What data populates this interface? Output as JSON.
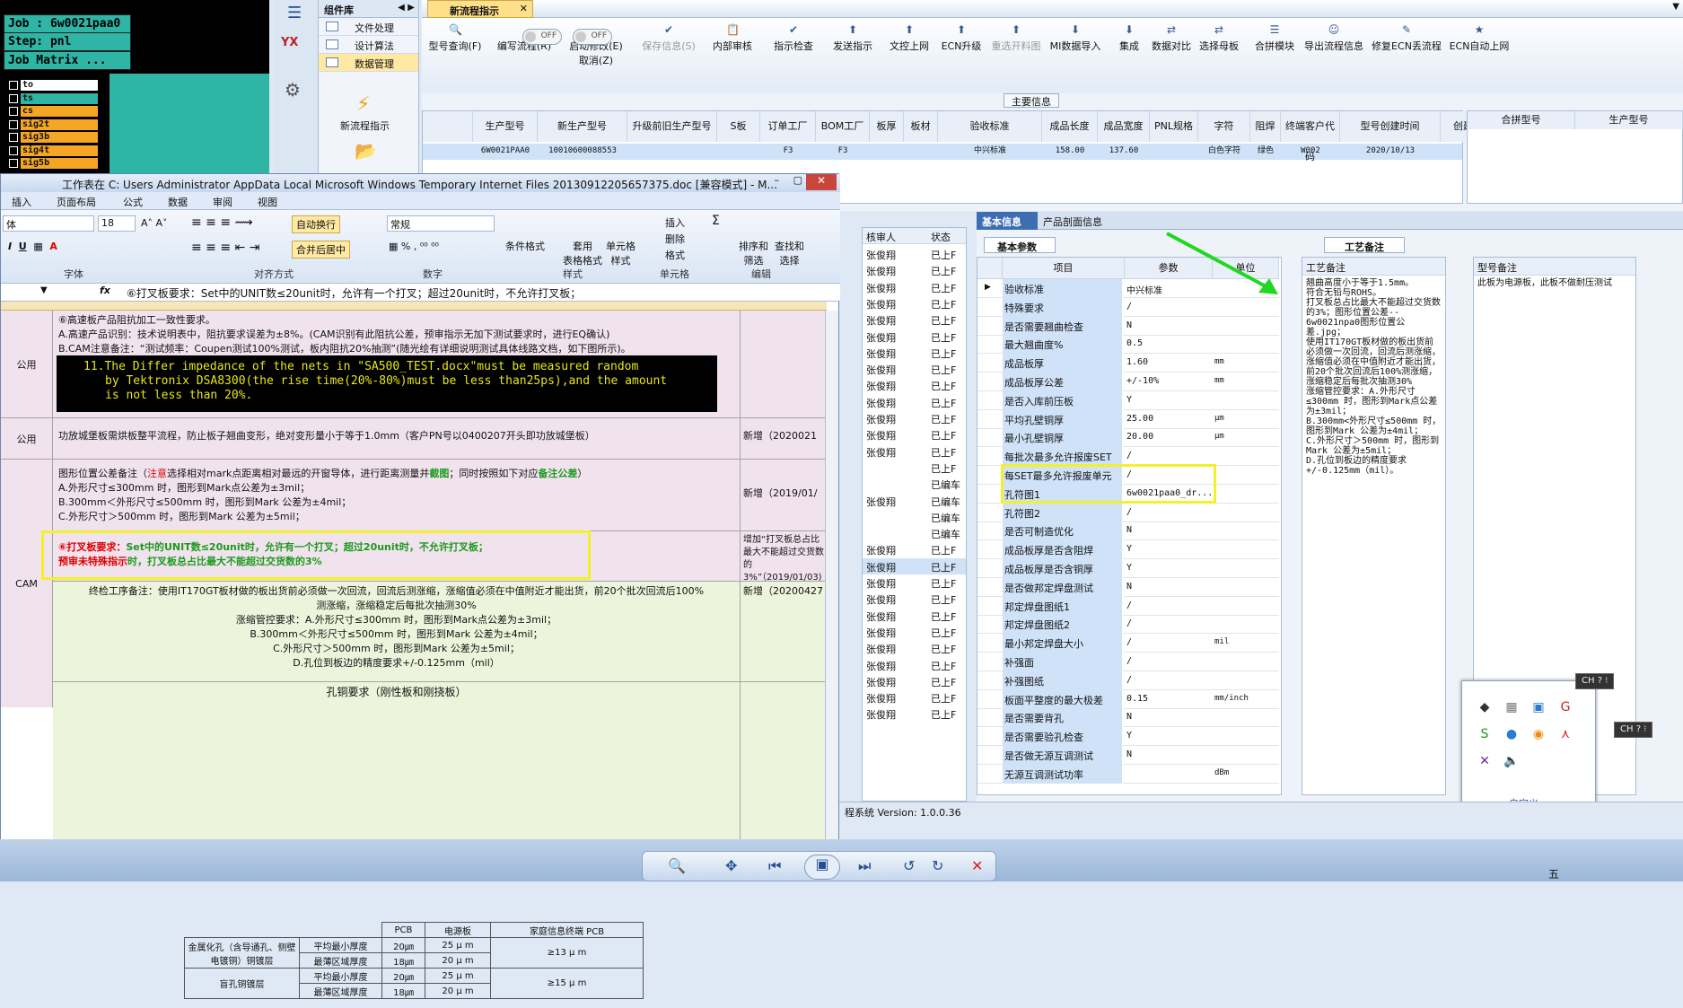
{
  "terminal": {
    "job_line": "Job : 6w0021paa0",
    "step_line": "Step: pnl",
    "matrix_btn": "Job Matrix ...",
    "layers": [
      {
        "name": "to",
        "color": "#ffffff"
      },
      {
        "name": "ts",
        "color": "#2fb5a5"
      },
      {
        "name": "cs",
        "color": "#f5a623"
      },
      {
        "name": "sig2t",
        "color": "#f5a623"
      },
      {
        "name": "sig3b",
        "color": "#f5a623"
      },
      {
        "name": "sig4t",
        "color": "#f5a623"
      },
      {
        "name": "sig5b",
        "color": "#f5a623"
      }
    ]
  },
  "sidebar": {
    "logo": "YX"
  },
  "component_lib": {
    "title": "组件库",
    "items": [
      "文件处理",
      "设计算法",
      "数据管理"
    ],
    "new_flow": "新流程指示",
    "open": "开启"
  },
  "app": {
    "tab": "新流程指示",
    "toolbar": [
      {
        "label": "型号查询(F)",
        "icon": "🔍"
      },
      {
        "label": "编写流程(R)",
        "icon": ""
      },
      {
        "label": "启动修改(E)\n取消(Z)",
        "icon": ""
      },
      {
        "label": "保存信息(S)",
        "icon": "✔",
        "disabled": true
      },
      {
        "label": "内部审核",
        "icon": "📋"
      },
      {
        "label": "指示检查",
        "icon": "✔"
      },
      {
        "label": "发送指示",
        "icon": "⬆"
      },
      {
        "label": "文控上网",
        "icon": "⬆"
      },
      {
        "label": "ECN升级",
        "icon": "⬆"
      },
      {
        "label": "重选开料图",
        "icon": "⬆",
        "disabled": true
      },
      {
        "label": "MI数据导入",
        "icon": "⬇"
      },
      {
        "label": "集成",
        "icon": "⬇"
      },
      {
        "label": "数据对比",
        "icon": "⇄"
      },
      {
        "label": "选择母板",
        "icon": "⇄"
      },
      {
        "label": "合拼模块",
        "icon": "☰"
      },
      {
        "label": "导出流程信息",
        "icon": "☺"
      },
      {
        "label": "修复ECN丢流程",
        "icon": "✎"
      },
      {
        "label": "ECN自动上网",
        "icon": "★"
      }
    ],
    "toggle_off": "OFF",
    "main_info": "主要信息",
    "grid": {
      "headers": [
        "生产型号",
        "新生产型号",
        "升级前旧生产型号",
        "S板",
        "订单工厂",
        "BOM工厂",
        "板厚",
        "板材",
        "验收标准",
        "成品长度",
        "成品宽度",
        "PNL规格",
        "字符",
        "阻焊",
        "终端客户代码",
        "型号创建时间",
        "创建人"
      ],
      "row": [
        "6W0021PAA0",
        "10010600088553",
        "",
        "",
        "F3",
        "F3",
        "",
        "",
        "中兴标准",
        "158.00",
        "137.60",
        "",
        "白色字符",
        "绿色",
        "W002",
        "2020/10/13",
        ""
      ]
    },
    "grid_right_headers": [
      "合拼型号",
      "生产型号"
    ]
  },
  "excel": {
    "title": "工作表在 C: Users Administrator AppData Local Microsoft Windows Temporary Internet Files 20130912205657375.doc [兼容模式] - M...",
    "tabs": [
      "插入",
      "页面布局",
      "公式",
      "数据",
      "审阅",
      "视图"
    ],
    "font_name": "体",
    "font_size": "18",
    "wrap": "自动换行",
    "merge": "合并后居中",
    "number_fmt": "常规",
    "buttons": [
      "条件格式",
      "套用\n表格格式",
      "单元格\n样式",
      "插入",
      "删除",
      "格式",
      "排序和\n筛选",
      "查找和\n选择"
    ],
    "groups": [
      "字体",
      "对齐方式",
      "数字",
      "样式",
      "单元格",
      "编辑"
    ],
    "formula": "⑥打叉板要求：Set中的UNIT数≤20unit时，允许有一个打叉；超过20unit时，不允许打叉板；",
    "rows": {
      "r1_lines": [
        "⑥高速板产品阻抗加工一致性要求。",
        "A.高速产品识别：技术说明表中，阻抗要求误差为±8%。(CAM识别有此阻抗公差，预审指示无加下测试要求时，进行EQ确认)",
        "B.CAM注意备注：“测试频率：Coupen测试100%测试，板内阻抗20%抽测”(随光绘有详细说明测试具体线路文档，如下图所示)。"
      ],
      "r1_label": "公用",
      "black_lines": [
        "11.The Differ impedance of the nets in \"SA500_TEST.docx\"must be measured random",
        "by Tektronix DSA8300(the rise time(20%-80%)must be less than25ps),and the amount",
        "is not less than 20%."
      ],
      "r2_label": "公用",
      "r2_text": "功放城堡板需烘板整平流程，防止板子翘曲变形，绝对变形量小于等于1.0mm（客户PN号以0400207开头即功放城堡板）",
      "r2_note": "新增（2020021",
      "cam_label": "CAM",
      "r3_line1": "图形位置公差备注（",
      "r3_attention": "注意",
      "r3_line1b": "选择相对mark点距离相对最远的开窗导体，进行距离测量并",
      "r3_shot": "截图",
      "r3_line1c": "；同时按照如下对应",
      "r3_tol": "备注公差",
      "r3_lines": [
        "A.外形尺寸≤300mm 时，图形到Mark点公差为±3mil；",
        "B.300mm＜外形尺寸≤500mm 时，图形到Mark 公差为±4mil；",
        "C.外形尺寸＞500mm 时，图形到Mark 公差为±5mil；"
      ],
      "r3_note": "新增（2019/01/",
      "r4_prefix": "⑥打叉板要求：",
      "r4_main": "Set中的UNIT数≤20unit时，允许有一个打叉；超过20unit时，不允许打叉板；",
      "r4_prefix2": "预审未特殊指示",
      "r4_main2": "时，打叉板总占比最大不能超过交货数的3%",
      "r4_note": "增加“打叉板总占比最大不能超过交货数的3%”（2019/01/03)",
      "r5_lines": [
        "终检工序备注：使用IT170GT板材做的板出货前必须做一次回流，回流后测涨缩，涨缩值必须在中值附近才能出货，前20个批次回流后100%",
        "测涨缩，涨缩稳定后每批次抽测30%",
        "涨缩管控要求：A.外形尺寸≤300mm 时，图形到Mark点公差为±3mil；",
        "B.300mm＜外形尺寸≤500mm 时，图形到Mark 公差为±4mil；",
        "C.外形尺寸＞500mm 时，图形到Mark 公差为±5mil；",
        "D.孔位到板边的精度要求+/-0.125mm（mil）"
      ],
      "r5_note": "新增（20200427",
      "r6_title": "孔铜要求（刚性板和刚挠板）",
      "sub_headers": [
        "PCB",
        "电源板",
        "家庭信息终端 PCB"
      ],
      "sub_rows": [
        [
          "金属化孔（含导通孔、侧壁电镀铜）铜镀层",
          "平均最小厚度",
          "20㎛",
          "25 μ m",
          "≥13 μ m"
        ],
        [
          "",
          "最薄区域厚度",
          "18㎛",
          "20 μ m",
          ""
        ],
        [
          "盲孔铜镀层",
          "平均最小厚度",
          "20㎛",
          "25 μ m",
          "≥15 μ m"
        ],
        [
          "",
          "最薄区域厚度",
          "18㎛",
          "20 μ m",
          ""
        ]
      ]
    }
  },
  "mid_list": {
    "headers": [
      "核审人",
      "状态"
    ],
    "rows": [
      [
        "张俊翔",
        "已上F"
      ],
      [
        "张俊翔",
        "已上F"
      ],
      [
        "张俊翔",
        "已上F"
      ],
      [
        "张俊翔",
        "已上F"
      ],
      [
        "张俊翔",
        "已上F"
      ],
      [
        "张俊翔",
        "已上F"
      ],
      [
        "张俊翔",
        "已上F"
      ],
      [
        "张俊翔",
        "已上F"
      ],
      [
        "张俊翔",
        "已上F"
      ],
      [
        "张俊翔",
        "已上F"
      ],
      [
        "张俊翔",
        "已上F"
      ],
      [
        "张俊翔",
        "已上F"
      ],
      [
        "张俊翔",
        "已上F"
      ],
      [
        "",
        "已上F"
      ],
      [
        "",
        "已编车"
      ],
      [
        "张俊翔",
        "已编车"
      ],
      [
        "",
        "已编车"
      ],
      [
        "",
        "已编车"
      ],
      [
        "张俊翔",
        "已上F"
      ],
      [
        "张俊翔",
        "已上F"
      ],
      [
        "张俊翔",
        "已上F"
      ],
      [
        "张俊翔",
        "已上F"
      ],
      [
        "张俊翔",
        "已上F"
      ],
      [
        "张俊翔",
        "已上F"
      ],
      [
        "张俊翔",
        "已上F"
      ],
      [
        "张俊翔",
        "已上F"
      ],
      [
        "张俊翔",
        "已上F"
      ],
      [
        "张俊翔",
        "已上F"
      ],
      [
        "张俊翔",
        "已上F"
      ]
    ]
  },
  "info": {
    "tab1": "基本信息",
    "tab2": "产品剖面信息",
    "param_tab": "基本参数",
    "headers": [
      "项目",
      "参数",
      "单位"
    ],
    "rows": [
      [
        "验收标准",
        "中兴标准",
        ""
      ],
      [
        "特殊要求",
        "/",
        ""
      ],
      [
        "是否需要翘曲检查",
        "N",
        ""
      ],
      [
        "最大翘曲度%",
        "0.5",
        ""
      ],
      [
        "成品板厚",
        "1.60",
        "mm"
      ],
      [
        "成品板厚公差",
        "+/-10%",
        "mm"
      ],
      [
        "是否入库前压板",
        "Y",
        ""
      ],
      [
        "平均孔壁铜厚",
        "25.00",
        "μm"
      ],
      [
        "最小孔壁铜厚",
        "20.00",
        "μm"
      ],
      [
        "每批次最多允许报废SET",
        "/",
        ""
      ],
      [
        "每SET最多允许报废单元",
        "/",
        ""
      ],
      [
        "孔符图1",
        "6w0021paa0_dr...",
        ""
      ],
      [
        "孔符图2",
        "/",
        ""
      ],
      [
        "是否可制造优化",
        "N",
        ""
      ],
      [
        "成品板厚是否含阻焊",
        "Y",
        ""
      ],
      [
        "成品板厚是否含铜厚",
        "Y",
        ""
      ],
      [
        "是否做邦定焊盘测试",
        "N",
        ""
      ],
      [
        "邦定焊盘图纸1",
        "/",
        ""
      ],
      [
        "邦定焊盘图纸2",
        "/",
        ""
      ],
      [
        "最小邦定焊盘大小",
        "/",
        "mil"
      ],
      [
        "补强面",
        "/",
        ""
      ],
      [
        "补强图纸",
        "/",
        ""
      ],
      [
        "板面平整度的最大极差",
        "0.15",
        "mm/inch"
      ],
      [
        "是否需要背孔",
        "N",
        ""
      ],
      [
        "是否需要验孔检查",
        "Y",
        ""
      ],
      [
        "是否做无源互调测试",
        "N",
        ""
      ],
      [
        "无源互调测试功率",
        "",
        "dBm"
      ]
    ],
    "craft_tab": "工艺备注",
    "craft_header": "工艺备注",
    "craft_text": "翘曲高度小于等于1.5mm。\n符合无铅与ROHS。\n打叉板总占比最大不能超过交货数的3%；图形位置公差--\n6w0021npa0图形位置公差.jpg；\n使用IT170GT板材做的板出货前必须做一次回流，回流后测涨缩，涨缩值必须在中值附近才能出货，前20个批次回流后100%测涨缩，涨缩稳定后每批次抽测30%\n涨缩管控要求：A.外形尺寸≤300mm 时，图形到Mark点公差为±3mil；\nB.300mm<外形尺寸≤500mm 时，图形到Mark 公差为±4mil；\nC.外形尺寸＞500mm 时，图形到Mark 公差为±5mil；\nD.孔位到板边的精度要求+/-0.125mm（mil）。",
    "model_header": "型号备注",
    "model_text": "此板为电源板，此板不做耐压测试"
  },
  "tray": {
    "link": "自定义...",
    "ime": "CH"
  },
  "status": {
    "text": "程系统  Version: 1.0.0.36"
  },
  "clock": "五"
}
